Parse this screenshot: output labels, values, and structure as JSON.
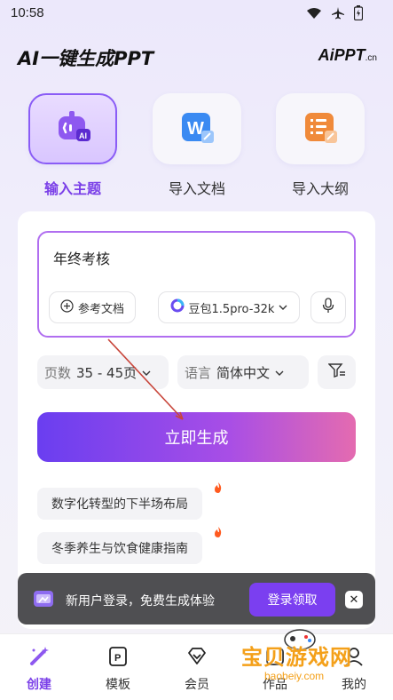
{
  "status_bar": {
    "time": "10:58"
  },
  "header": {
    "title": "AI一键生成PPT",
    "logo_main": "AiPPT",
    "logo_suffix": ".cn"
  },
  "modes": [
    {
      "label": "输入主题",
      "active": true
    },
    {
      "label": "导入文档",
      "active": false
    },
    {
      "label": "导入大纲",
      "active": false
    }
  ],
  "input": {
    "value": "年终考核",
    "ref_doc_label": "参考文档",
    "model_label": "豆包1.5pro-32k"
  },
  "options": {
    "pages_key": "页数",
    "pages_value": "35 - 45页",
    "lang_key": "语言",
    "lang_value": "简体中文"
  },
  "generate_label": "立即生成",
  "suggestions": [
    "数字化转型的下半场布局",
    "冬季养生与饮食健康指南"
  ],
  "toast": {
    "text": "新用户登录，免费生成体验",
    "button": "登录领取",
    "close": "✕"
  },
  "nav": [
    {
      "label": "创建",
      "active": true
    },
    {
      "label": "模板",
      "active": false
    },
    {
      "label": "会员",
      "active": false
    },
    {
      "label": "作品",
      "active": false
    },
    {
      "label": "我的",
      "active": false
    }
  ],
  "watermark": {
    "text": "宝贝游戏网",
    "url": "baobeiy.com"
  },
  "colors": {
    "accent": "#7a3fe8",
    "gradient_start": "#6a3ef0",
    "gradient_end": "#e46bb0"
  }
}
